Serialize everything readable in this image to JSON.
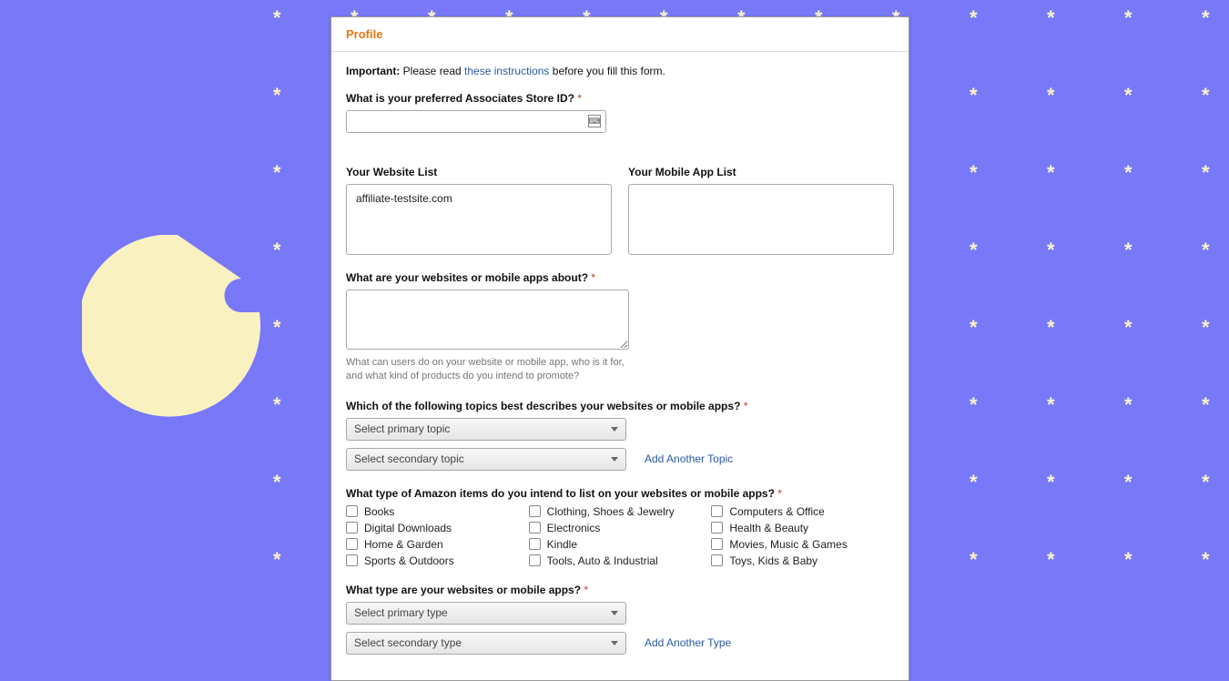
{
  "header": {
    "title": "Profile"
  },
  "important": {
    "label": "Important:",
    "before": " Please read ",
    "link": "these instructions",
    "after": " before you fill this form."
  },
  "storeId": {
    "label": "What is your preferred Associates Store ID? "
  },
  "websiteList": {
    "label": "Your Website List",
    "value": "affiliate-testsite.com"
  },
  "mobileAppList": {
    "label": "Your Mobile App List",
    "value": ""
  },
  "about": {
    "label": "What are your websites or mobile apps about? ",
    "hint": "What can users do on your website or mobile app, who is it for, and what kind of products do you intend to promote?"
  },
  "topics": {
    "label": "Which of the following topics best describes your websites or mobile apps? ",
    "primary": "Select primary topic",
    "secondary": "Select secondary topic",
    "addLink": "Add Another Topic"
  },
  "itemTypes": {
    "label": "What type of Amazon items do you intend to list on your websites or mobile apps? ",
    "items": [
      "Books",
      "Clothing, Shoes & Jewelry",
      "Computers & Office",
      "Digital Downloads",
      "Electronics",
      "Health & Beauty",
      "Home & Garden",
      "Kindle",
      "Movies, Music & Games",
      "Sports & Outdoors",
      "Tools, Auto & Industrial",
      "Toys, Kids & Baby"
    ]
  },
  "siteTypes": {
    "label": "What type are your websites or mobile apps? ",
    "primary": "Select primary type",
    "secondary": "Select secondary type",
    "addLink": "Add Another Type"
  },
  "req": "*"
}
